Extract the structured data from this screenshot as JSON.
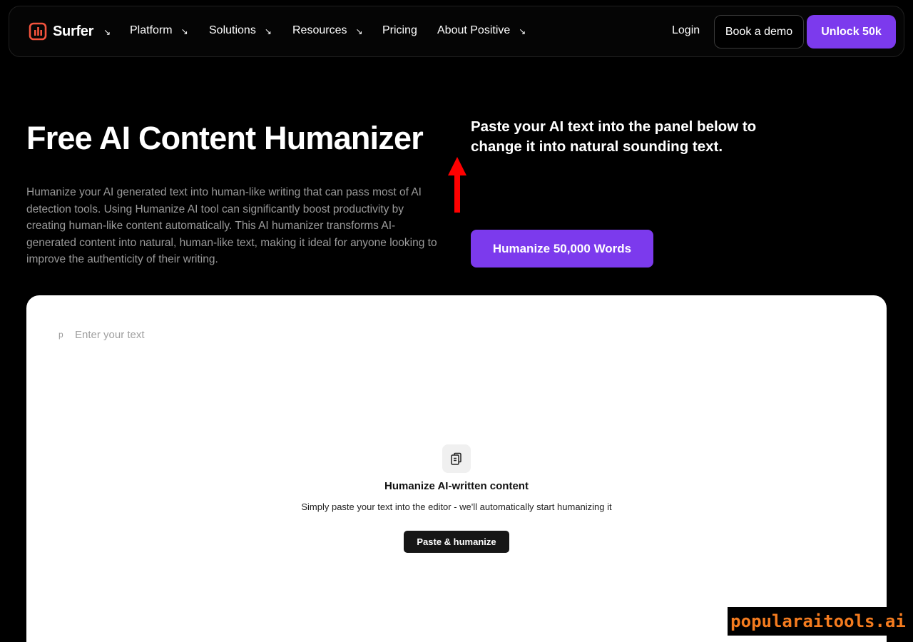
{
  "nav": {
    "logo_text": "Surfer",
    "logo_arrow": "↘",
    "items": [
      {
        "label": "Platform",
        "arrow": "↘"
      },
      {
        "label": "Solutions",
        "arrow": "↘"
      },
      {
        "label": "Resources",
        "arrow": "↘"
      },
      {
        "label": "Pricing",
        "arrow": ""
      },
      {
        "label": "About Positive",
        "arrow": "↘"
      }
    ],
    "login_label": "Login",
    "demo_label": "Book a demo",
    "unlock_label": "Unlock 50k"
  },
  "hero": {
    "title": "Free AI Content Humanizer",
    "description": "Humanize your AI generated text into human-like writing that can pass most of AI detection tools. Using Humanize AI tool can significantly boost productivity by creating human-like content automatically. This AI humanizer transforms AI-generated content into natural, human-like text, making it ideal for anyone looking to improve the authenticity of their writing.",
    "right_text": "Paste your AI text into the panel below to change it into natural sounding text.",
    "cta_label": "Humanize 50,000 Words"
  },
  "editor": {
    "paragraph_marker": "p",
    "placeholder": "Enter your text",
    "empty_title": "Humanize AI-written content",
    "empty_desc": "Simply paste your text into the editor - we'll automatically start humanizing it",
    "paste_button_label": "Paste & humanize"
  },
  "watermark": {
    "text": "popularaitools.ai"
  },
  "colors": {
    "accent": "#7c3aed",
    "logo": "#f4533d",
    "watermark": "#f57c1f",
    "annotation_arrow": "#ff0000"
  }
}
